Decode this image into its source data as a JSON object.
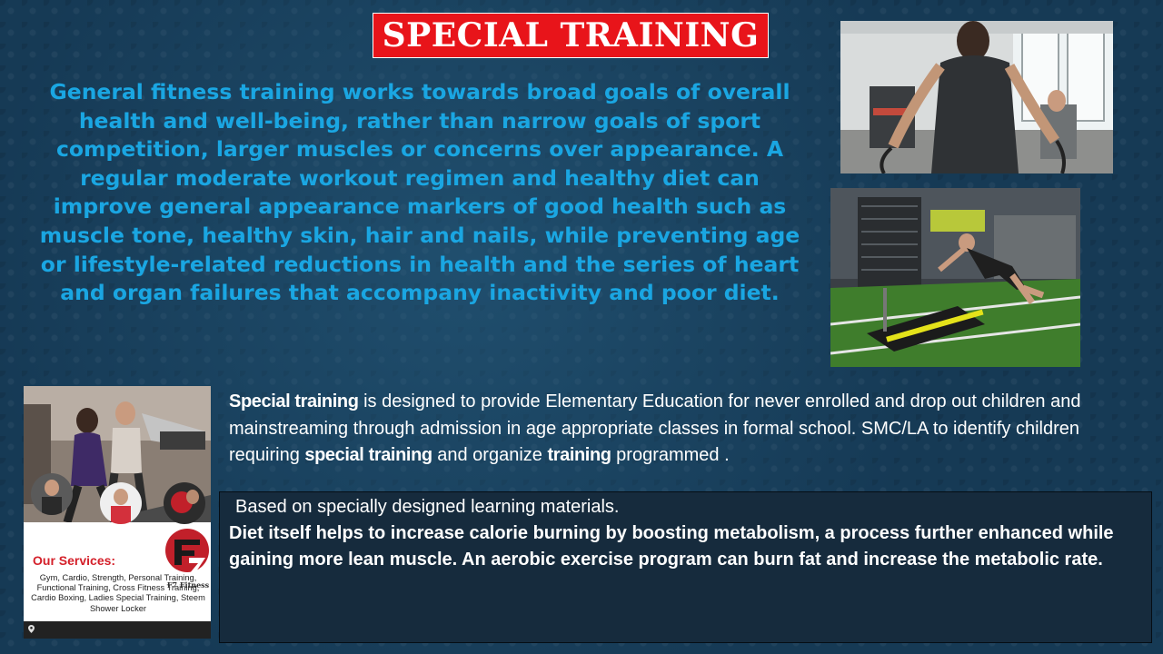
{
  "slide": {
    "title": "SPECIAL TRAINING",
    "intro": "General fitness training works towards broad goals of overall health and well-being, rather than narrow goals of sport competition, larger muscles or concerns over appearance. A regular moderate workout regimen and healthy diet can improve general appearance markers of good health such as muscle tone, healthy skin, hair and nails, while preventing age or lifestyle-related reductions in health and the series of heart and organ failures that accompany inactivity and poor diet.",
    "special_para": {
      "bold_1": "Special training",
      "text_1": " is designed to provide Elementary Education for never enrolled and drop out children and mainstreaming through admission in age appropriate classes in formal school. SMC/LA to identify children requiring ",
      "bold_2": "special training",
      "text_2": " and organize ",
      "bold_3": "training",
      "text_3": " programmed ."
    },
    "info_box": {
      "line1": "Based on specially designed learning materials.",
      "line2": "Diet itself helps to increase calorie burning by boosting metabolism, a process further enhanced while gaining more lean muscle. An aerobic exercise program can burn fat and increase the metabolic rate."
    }
  },
  "flyer": {
    "brand": "F7 Fitness",
    "services_title": "Our Services:",
    "services": "Gym, Cardio, Strength, Personal Training, Functional Training, Cross Fitness Training, Cardio Boxing, Ladies Special Training, Steem Shower Locker"
  },
  "colors": {
    "background": "#163a55",
    "title_bg": "#e8141a",
    "intro_text": "#1aa6e2",
    "info_box_bg": "#162b3d"
  },
  "icons": {
    "location": "map-pin-icon",
    "logo": "f7-logo-icon"
  }
}
